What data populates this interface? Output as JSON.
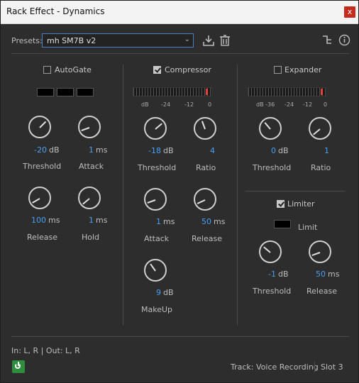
{
  "window": {
    "title": "Rack Effect - Dynamics",
    "close_label": "x"
  },
  "presets": {
    "label": "Presets:",
    "selected": "mh SM7B v2"
  },
  "autogate": {
    "label": "AutoGate",
    "threshold": {
      "value": "-20",
      "unit": "dB",
      "label": "Threshold"
    },
    "attack": {
      "value": "1",
      "unit": "ms",
      "label": "Attack"
    },
    "release": {
      "value": "100",
      "unit": "ms",
      "label": "Release"
    },
    "hold": {
      "value": "1",
      "unit": "ms",
      "label": "Hold"
    }
  },
  "compressor": {
    "label": "Compressor",
    "meter_ticks": [
      "dB",
      "-24",
      "-12",
      "0"
    ],
    "threshold": {
      "value": "-18",
      "unit": "dB",
      "label": "Threshold"
    },
    "ratio": {
      "value": "4",
      "label": "Ratio"
    },
    "attack": {
      "value": "1",
      "unit": "ms",
      "label": "Attack"
    },
    "release": {
      "value": "50",
      "unit": "ms",
      "label": "Release"
    },
    "makeup": {
      "value": "9",
      "unit": "dB",
      "label": "MakeUp"
    }
  },
  "expander": {
    "label": "Expander",
    "meter_ticks": [
      "dB -36",
      "-24",
      "-12",
      "0"
    ],
    "threshold": {
      "value": "0",
      "unit": "dB",
      "label": "Threshold"
    },
    "ratio": {
      "value": "1",
      "label": "Ratio"
    }
  },
  "limiter": {
    "label": "Limiter",
    "limit_label": "Limit",
    "threshold": {
      "value": "-1",
      "unit": "dB",
      "label": "Threshold"
    },
    "release": {
      "value": "50",
      "unit": "ms",
      "label": "Release"
    }
  },
  "footer": {
    "io": "In: L, R | Out: L, R",
    "track": "Track: Voice Recording",
    "slot": "Slot 3"
  },
  "colors": {
    "accent": "#4a9ff5",
    "meter_peak": "#e0443a",
    "power": "#2f8e3b"
  }
}
